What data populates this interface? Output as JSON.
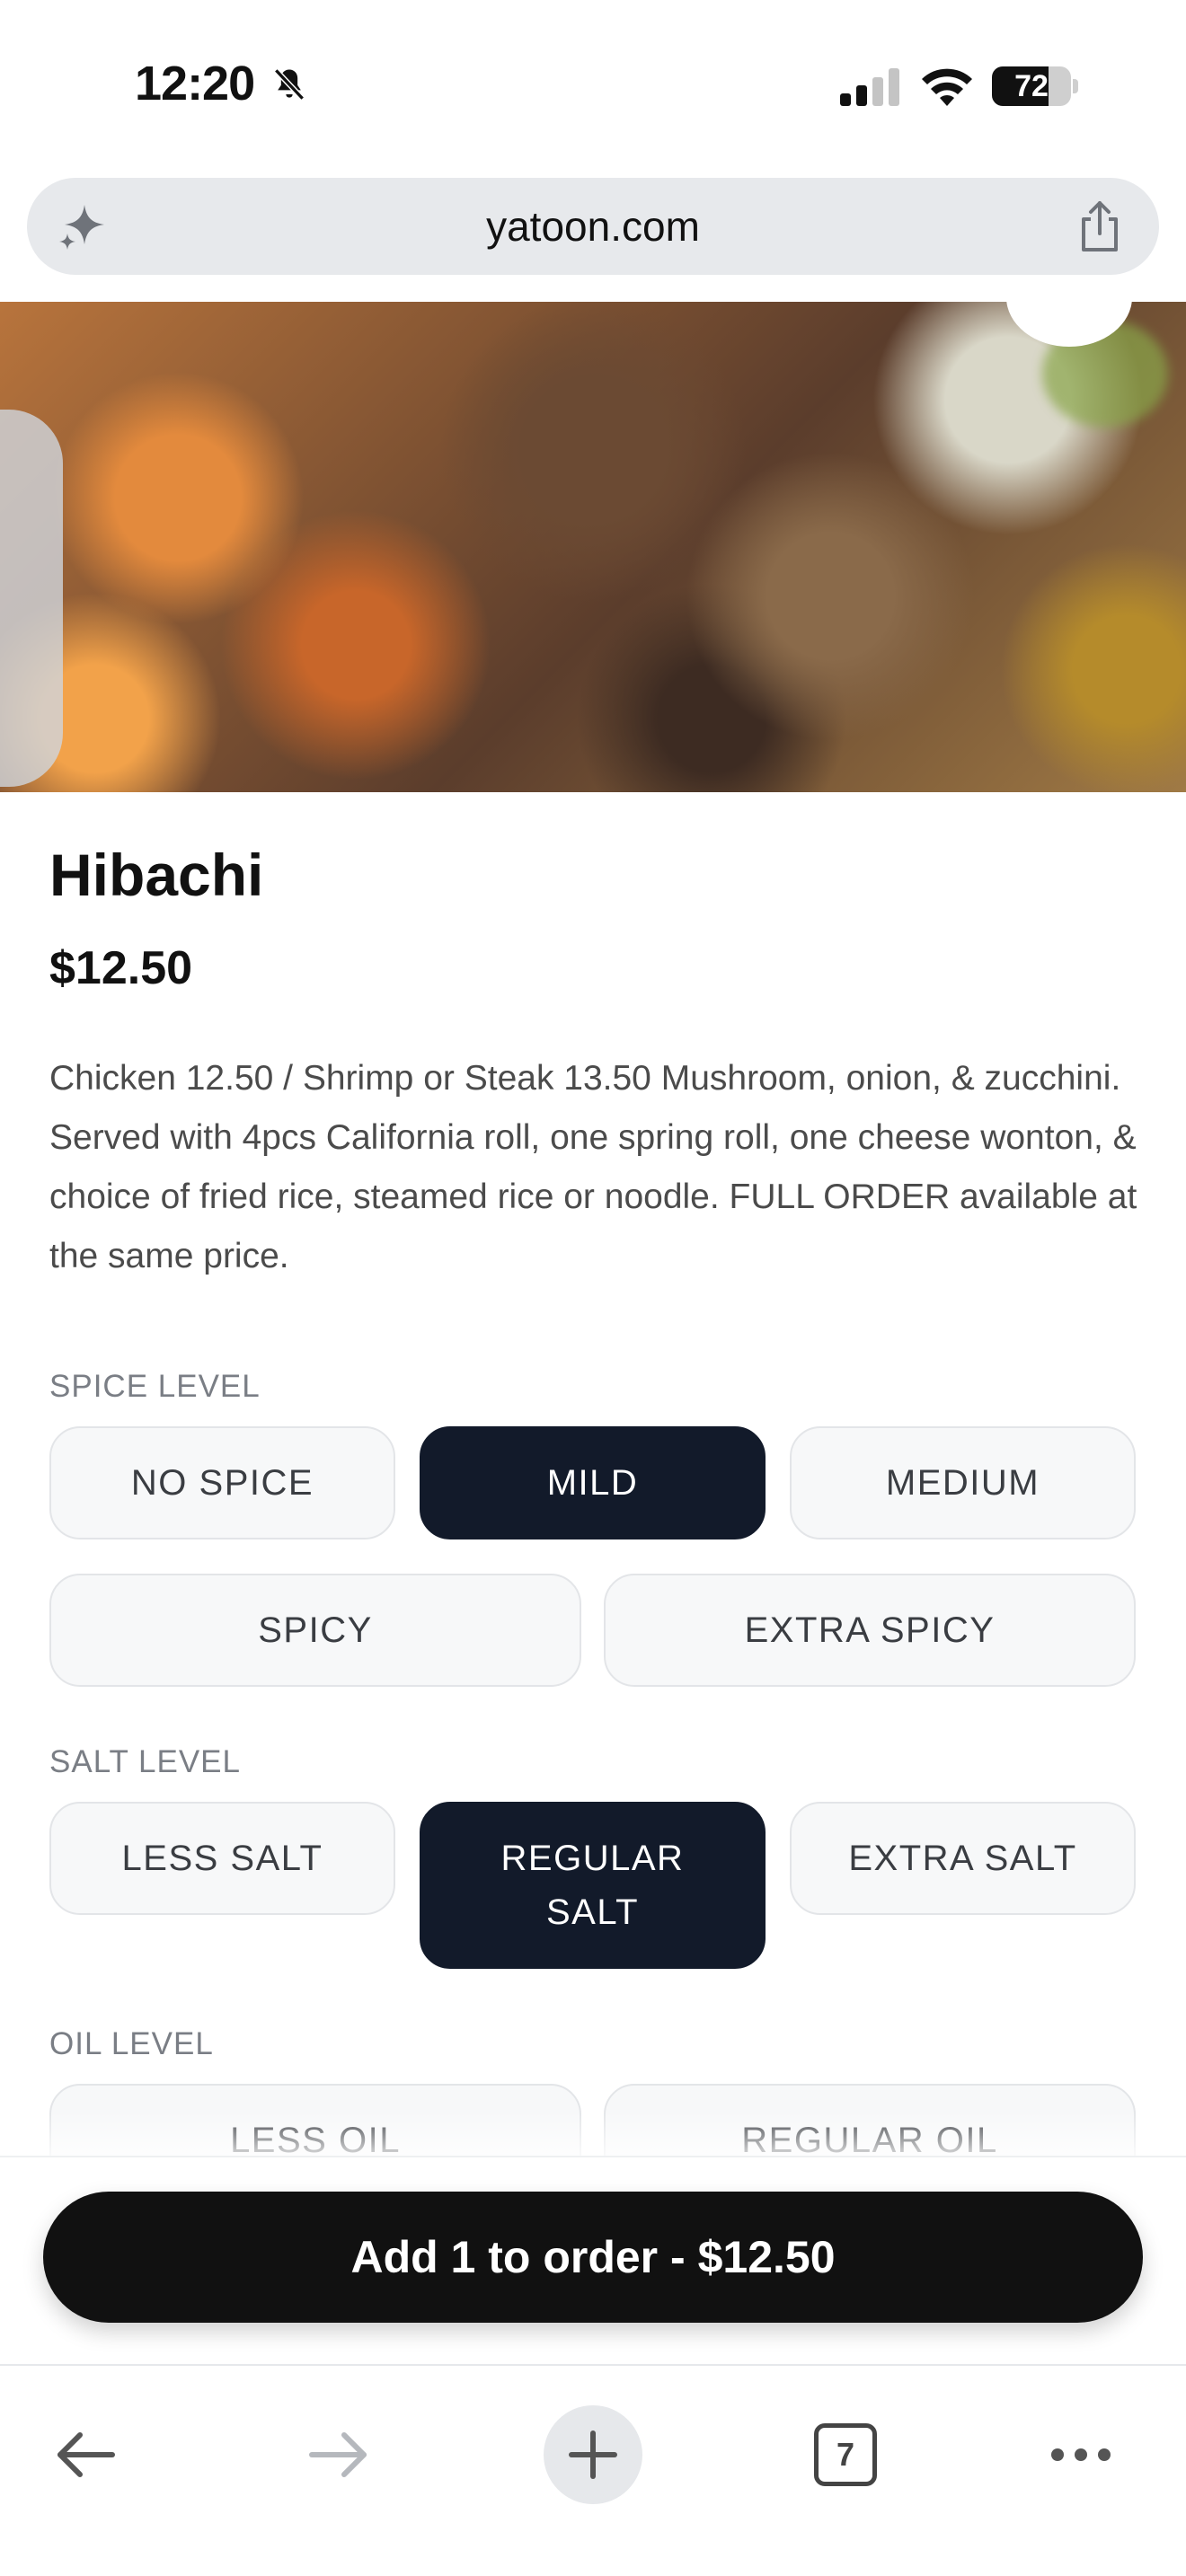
{
  "status_bar": {
    "time": "12:20",
    "battery_percent": "72",
    "battery_level": 0.72
  },
  "browser": {
    "url": "yatoon.com",
    "open_tab_count": "7"
  },
  "item": {
    "title": "Hibachi",
    "price": "$12.50",
    "description": "Chicken 12.50 / Shrimp or Steak 13.50 Mushroom, onion, & zucchini. Served with 4pcs California roll, one spring roll, one cheese wonton, & choice of fried rice, steamed rice or noodle. FULL ORDER available at the same price."
  },
  "options": {
    "spice": {
      "label": "SPICE LEVEL",
      "choices": [
        "NO SPICE",
        "MILD",
        "MEDIUM",
        "SPICY",
        "EXTRA SPICY"
      ],
      "selected": "MILD"
    },
    "salt": {
      "label": "SALT LEVEL",
      "choices": [
        "LESS SALT",
        "REGULAR SALT",
        "EXTRA SALT"
      ],
      "selected": "REGULAR SALT"
    },
    "oil": {
      "label": "OIL LEVEL",
      "choices": [
        "LESS OIL",
        "REGULAR OIL"
      ]
    }
  },
  "order": {
    "button_label": "Add 1 to order - $12.50"
  },
  "colors": {
    "selected_option": "#121a2a",
    "order_button": "#111111",
    "description_text": "#4b4b4b",
    "section_label": "#7a7e85"
  },
  "icons": [
    "bell-slash-icon",
    "signal-icon",
    "wifi-icon",
    "battery-icon",
    "sparkle-icon",
    "share-icon",
    "back-arrow-icon",
    "forward-arrow-icon",
    "plus-icon",
    "tabs-icon",
    "more-icon"
  ]
}
